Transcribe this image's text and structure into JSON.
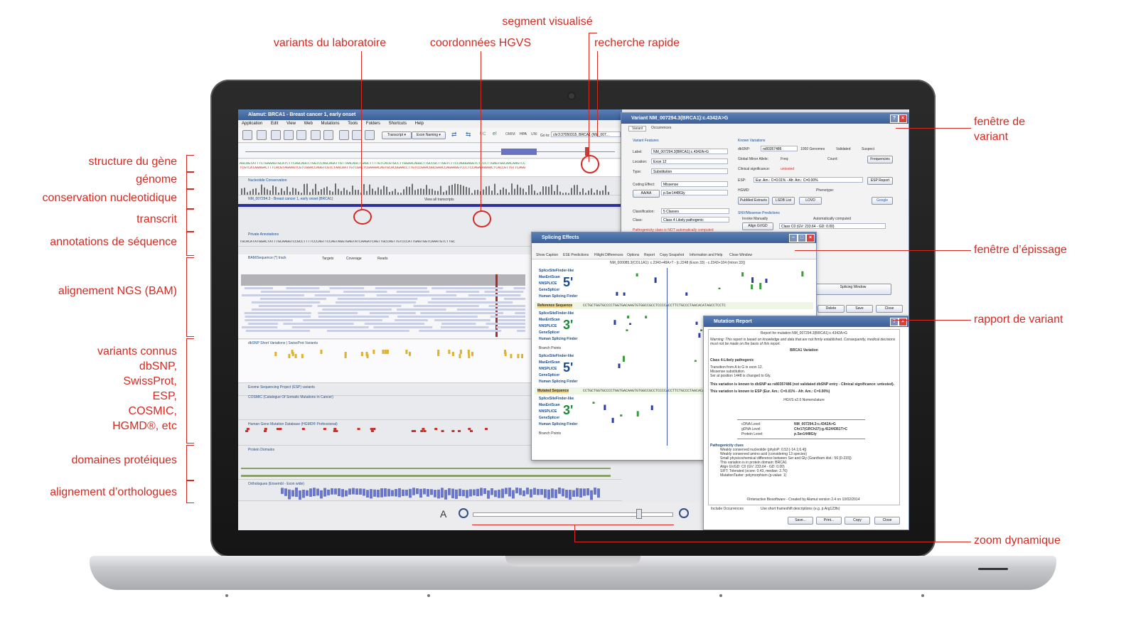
{
  "annotations_top": {
    "segment": "segment visualisé",
    "lab_variants": "variants du laboratoire",
    "hgvs": "coordonnées HGVS",
    "quick_search": "recherche rapide"
  },
  "annotations_left": {
    "gene_structure": "structure du gène",
    "genome": "génome",
    "conservation": "conservation nucleotidique",
    "transcript": "transcrit",
    "sequence_annotations": "annotations de séquence",
    "ngs_alignment": "alignement NGS (BAM)",
    "known_variants": [
      "variants connus",
      "dbSNP,",
      "SwissProt,",
      "ESP,",
      "COSMIC,",
      "HGMD®, etc"
    ],
    "protein_domains": "domaines protéiques",
    "orthologs": "alignement d’orthologues"
  },
  "annotations_right": {
    "variant_window": [
      "fenêtre de",
      "variant"
    ],
    "splicing_window": "fenêtre d’épissage",
    "variant_report": "rapport de variant",
    "dynamic_zoom": "zoom dynamique"
  },
  "colors": {
    "annotation": "#d42a22",
    "titlebar": "#3b5f96",
    "read_bar": "#2d2f9a",
    "conservation": "#6d6d6d"
  },
  "app": {
    "main_title": "Alamut: BRCA1 - Breast cancer 1, early onset",
    "menu": [
      "Application",
      "Edit",
      "View",
      "Web",
      "Mutations",
      "Tools",
      "Folders",
      "Shortcuts",
      "Help"
    ],
    "goto_label": "Go to:",
    "goto_value": "chr3:37050315, BRCA1 (NM_007...",
    "transcript_select": "Transcript",
    "exon_naming_select": "Exon Naming",
    "tracks": {
      "conservation": "Nucleotide Conservation",
      "transcript": "NM_007294.3 - Breast cancer 1, early onset (BRCA1)",
      "view_all": "View all transcripts",
      "private_annotations": "Private Annotations",
      "bam": "BAM/Sequence (*) track",
      "targets": "Targets",
      "coverage": "Coverage",
      "reads": "Reads",
      "dbsnp": "dbSNP Short Variations | SwissProt Variants",
      "esp": "Exome Sequencing Project (ESP) variants",
      "cosmic": "COSMIC (Catalogue Of Somatic Mutations In Cancer)",
      "hgmd": "Human Gene Mutation Database (HGMD® Professional)",
      "protein": "Protein Domains",
      "orthologs": "Orthologues (Ensembl - Exon wide)"
    }
  },
  "variant_window": {
    "title": "Variant NM_007294.3(BRCA1):c.4342A>G",
    "tabs": [
      "Variant",
      "Occurrences"
    ],
    "features_title": "Variant Features",
    "label_label": "Label:",
    "label_value": "NM_007294.3(BRCA1):c.4342A>G",
    "location_label": "Location:",
    "location_value": "Exon 12",
    "type_label": "Type:",
    "type_value": "Substitution",
    "coding_effect_label": "Coding Effect:",
    "coding_effect_value": "Missense",
    "protein_value": "p.Ser1448Gly",
    "aa_button": "AA/AA",
    "classification_label": "Classification:",
    "classification_value": "5 Classes",
    "class_label": "Class:",
    "class_value": "Class 4 Likely pathogenic",
    "pathogenicity_note": "Pathogenicity class is NOT automatically computed",
    "known_title": "Known Variations",
    "dbsnp_label": "dbSNP:",
    "dbsnp_value": "rs80357486",
    "g1000": "1000 Genomes",
    "validated": "Validated",
    "suspect": "Suspect",
    "maf_label": "Global Minor Allele:",
    "freq_label": "Freq:",
    "count_label": "Count:",
    "frequencies_btn": "Frequencies",
    "clin_label": "Clinical significance:",
    "clin_value": "untested",
    "esp_label": "ESP:",
    "esp_value": "Eur. Am.: C=0.01% - Afr. Am.: C=0.00%",
    "esp_report": "ESP Report",
    "hgmd_label": "HGMD:",
    "phenotype_label": "Phenotype:",
    "pubmed_btn": "PubMed Extracts",
    "lsdb_btn": "LSDB List",
    "lovd_btn": "LOVD",
    "google_btn": "Google",
    "snv_title": "SNV/Missense Predictions",
    "invoke": "Invoke Manually",
    "auto": "Automatically computed",
    "align_btn": "Align GVGD",
    "gvgd_value": "Class C0 (GV: 233.64 - GD: 0.00)",
    "splicing_btn": "Splicing Window",
    "delete_btn": "Delete",
    "save_btn": "Save",
    "close_btn": "Close"
  },
  "splicing_window": {
    "title": "Splicing Effects",
    "tools": [
      "Show Caption",
      "ESE Predictions",
      "Hilight Differences",
      "Options",
      "Report",
      "Copy Snapshot",
      "Information and Help",
      "Close Window"
    ],
    "header": "NM_000085.3(COL1A1): c.2343+48A>T - [c.2248 (Exon 33) - c.2343+104 (Intron 33)]",
    "predictors": [
      "SpliceSiteFinder-like",
      "MaxEntScan",
      "NNSPLICE",
      "GeneSplicer",
      "Human Splicing Finder"
    ],
    "five": "5'",
    "three": "3'",
    "reference": "Reference Sequence",
    "mutated": "Mutated Sequence",
    "branch": "Branch Points",
    "ref_seq": "CCTGCTGGTGCCCCTGGTGACAAGTGTGGCCGCCTCCCCACCTTCTGCCCTAACACATAGCCTCCTC",
    "mut_seq": "CCTGCTGGTGCCCCTGGTGACAAGTGTGGCCGCCTCCCCACCTTCTGCCCTAACACATAGCCTCCTC"
  },
  "report_window": {
    "title": "Mutation Report",
    "heading": "Report for mutation NM_007294.3(BRCA1):c.4342A>G",
    "warning": "Warning: This report is based on knowledge and data that are not firmly established. Consequently, medical decisions must not be made on the basis of this report.",
    "gene": "BRCA1 Variation",
    "class": "Class 4-Likely pathogenic",
    "lines": [
      "Transition from A to G in exon 12.",
      "Missense substitution.",
      "Ser at position 1448 is changed to Gly."
    ],
    "dbsnp_line": "This variation is known to dbSNP as rs80357486 (not validated dbSNP entry - Clinical significance: untested).",
    "esp_line": "This variation is known to ESP (Eur. Am.: C=0.01% - Afr. Am.: C=0.00%)",
    "hgvs_title": "HGVS v2.0 Nomenclature",
    "cdna_label": "cDNA Level:",
    "cdna_value": "NM_007294.3:c.4342A>G",
    "gdna_label": "gDNA Level:",
    "gdna_value": "Chr17(GRCh37):g.41244361T>C",
    "protein_label": "Protein Level:",
    "protein_value": "p.Ser1448Gly",
    "path_title": "Pathogenicity clues",
    "clues": [
      "Weakly conserved nucleotide (phyloP: 0.53 [-14.1;6.4])",
      "Weakly conserved amino acid (considering 13 species)",
      "Small physicochemical difference between Ser and Gly (Grantham dist.: 56 [0-215])",
      "This variation is in protein domain: BRCA1",
      "Align GVGD: C0 (GV: 233.64 - GD: 0.00)",
      "SIFT: Tolerated (score: 0.43, median: 2.76)",
      "MutationTaster: polymorphism (p-value: 1)"
    ],
    "footer": "©Interactive Biosoftware - Created by Alamut version 2.4 on 10/02/2014",
    "include_occ": "Include Occurrences",
    "use_short": "Use short frameshift descriptions (e.g. p.Arg123fs)",
    "save_btn": "Save...",
    "print_btn": "Print...",
    "copy_btn": "Copy",
    "close_btn": "Close"
  }
}
